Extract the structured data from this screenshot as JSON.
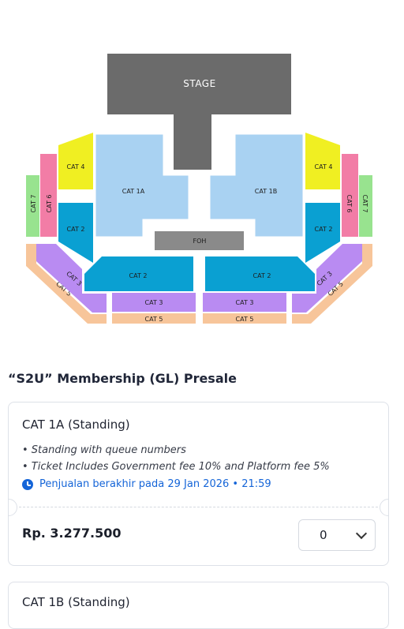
{
  "venue_map": {
    "stage": "STAGE",
    "foh": "FOH",
    "cat1a": "CAT 1A",
    "cat1b": "CAT 1B",
    "cat2": "CAT 2",
    "cat3": "CAT 3",
    "cat4": "CAT 4",
    "cat5": "CAT 5",
    "cat6": "CAT 6",
    "cat7": "CAT 7",
    "colors": {
      "stage": "#6b6b6b",
      "cat1": "#a9d2f2",
      "cat2": "#0aa0d2",
      "cat3": "#b98bf2",
      "cat4": "#f0ef22",
      "cat5": "#f7c59a",
      "cat6": "#f27da6",
      "cat7": "#98e38f",
      "foh": "#8a8a8a"
    }
  },
  "presale": {
    "title": "“S2U” Membership (GL) Presale"
  },
  "tickets": [
    {
      "name": "CAT 1A (Standing)",
      "features": [
        "• Standing with queue numbers",
        "• Ticket Includes Government fee 10% and Platform fee 5%"
      ],
      "sale_end": "Penjualan berakhir pada 29 Jan 2026 • 21:59",
      "price": "Rp. 3.277.500",
      "quantity": "0"
    },
    {
      "name": "CAT 1B (Standing)"
    }
  ]
}
